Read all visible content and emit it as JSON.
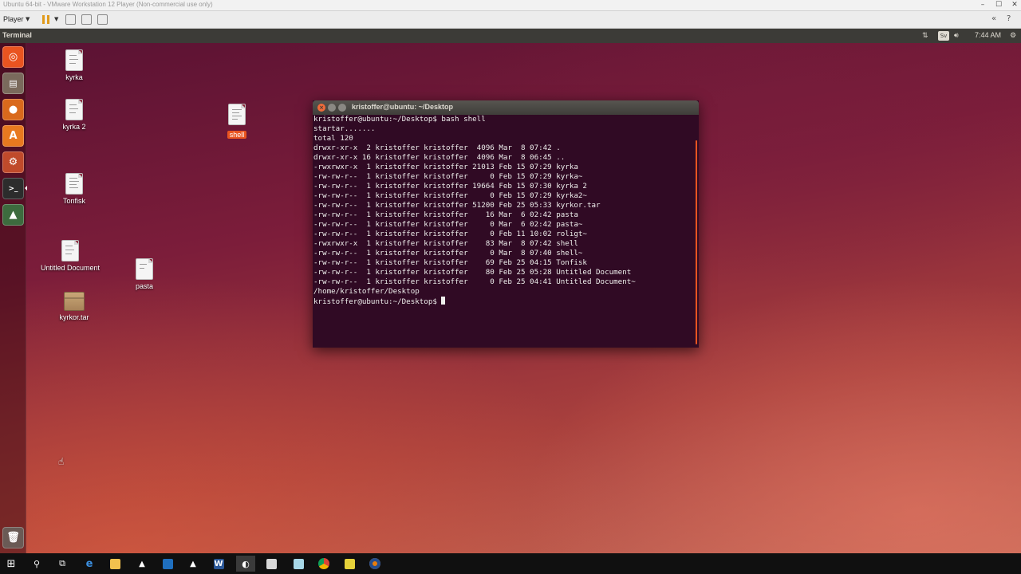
{
  "vmware": {
    "title": "Ubuntu 64-bit - VMware Workstation 12 Player (Non-commercial use only)",
    "player_menu": "Player",
    "window_controls": [
      "–",
      "☐",
      "✕"
    ]
  },
  "panel": {
    "app_name": "Terminal",
    "keyboard_layout": "Sv",
    "clock": "7:44 AM"
  },
  "launcher": {
    "items": [
      "Dash Home",
      "Files",
      "Firefox",
      "Ubuntu Software Center",
      "System Settings",
      "Terminal",
      "Software Updater",
      "Trash"
    ]
  },
  "desktop_icons": [
    {
      "label": "kyrka"
    },
    {
      "label": "kyrka 2"
    },
    {
      "label": "Tonfisk"
    },
    {
      "label": "Untitled Document"
    },
    {
      "label": "kyrkor.tar"
    },
    {
      "label": "pasta"
    },
    {
      "label": "shell"
    }
  ],
  "terminal": {
    "window_title": "kristoffer@ubuntu: ~/Desktop",
    "lines": [
      "kristoffer@ubuntu:~/Desktop$ bash shell",
      "startar.......",
      "total 120",
      "drwxr-xr-x  2 kristoffer kristoffer  4096 Mar  8 07:42 .",
      "drwxr-xr-x 16 kristoffer kristoffer  4096 Mar  8 06:45 ..",
      "-rwxrwxr-x  1 kristoffer kristoffer 21013 Feb 15 07:29 kyrka",
      "-rw-rw-r--  1 kristoffer kristoffer     0 Feb 15 07:29 kyrka~",
      "-rw-rw-r--  1 kristoffer kristoffer 19664 Feb 15 07:30 kyrka 2",
      "-rw-rw-r--  1 kristoffer kristoffer     0 Feb 15 07:29 kyrka2~",
      "-rw-rw-r--  1 kristoffer kristoffer 51200 Feb 25 05:33 kyrkor.tar",
      "-rw-rw-r--  1 kristoffer kristoffer    16 Mar  6 02:42 pasta",
      "-rw-rw-r--  1 kristoffer kristoffer     0 Mar  6 02:42 pasta~",
      "-rw-rw-r--  1 kristoffer kristoffer     0 Feb 11 10:02 roligt~",
      "-rwxrwxr-x  1 kristoffer kristoffer    83 Mar  8 07:42 shell",
      "-rw-rw-r--  1 kristoffer kristoffer     0 Mar  8 07:40 shell~",
      "-rw-rw-r--  1 kristoffer kristoffer    69 Feb 25 04:15 Tonfisk",
      "-rw-rw-r--  1 kristoffer kristoffer    80 Feb 25 05:28 Untitled Document",
      "-rw-rw-r--  1 kristoffer kristoffer     0 Feb 25 04:41 Untitled Document~",
      "/home/kristoffer/Desktop"
    ],
    "prompt": "kristoffer@ubuntu:~/Desktop$"
  },
  "taskbar": {
    "items": [
      "Start",
      "Search",
      "Task View",
      "Edge",
      "File Explorer",
      "App",
      "Outlook",
      "App",
      "Word",
      "VMware",
      "App",
      "App",
      "Chrome",
      "App",
      "Blender"
    ]
  },
  "colors": {
    "ubuntu_orange": "#e95420",
    "terminal_bg": "#300a24",
    "panel_bg": "#3c3b37"
  }
}
